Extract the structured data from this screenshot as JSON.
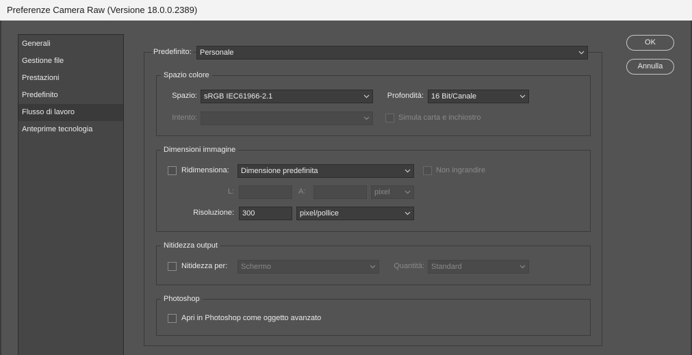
{
  "window": {
    "title": "Preferenze Camera Raw  (Versione 18.0.0.2389)"
  },
  "sidebar": {
    "items": [
      {
        "label": "Generali"
      },
      {
        "label": "Gestione file"
      },
      {
        "label": "Prestazioni"
      },
      {
        "label": "Predefinito"
      },
      {
        "label": "Flusso di lavoro",
        "selected": true
      },
      {
        "label": "Anteprime tecnologia"
      }
    ]
  },
  "preset": {
    "label": "Predefinito:",
    "value": "Personale"
  },
  "color_space": {
    "title": "Spazio colore",
    "space_label": "Spazio:",
    "space_value": "sRGB IEC61966-2.1",
    "depth_label": "Profondità:",
    "depth_value": "16 Bit/Canale",
    "intent_label": "Intento:",
    "intent_value": "",
    "simulate_label": "Simula carta e inchiostro"
  },
  "image_size": {
    "title": "Dimensioni immagine",
    "resize_label": "Ridimensiona:",
    "resize_value": "Dimensione predefinita",
    "no_enlarge_label": "Non ingrandire",
    "width_label": "L:",
    "height_label": "A:",
    "unit_value": "pixel",
    "resolution_label": "Risoluzione:",
    "resolution_value": "300",
    "resolution_unit": "pixel/pollice"
  },
  "sharpening": {
    "title": "Nitidezza output",
    "sharpen_label": "Nitidezza per:",
    "sharpen_value": "Schermo",
    "amount_label": "Quantità:",
    "amount_value": "Standard"
  },
  "photoshop": {
    "title": "Photoshop",
    "smart_object_label": "Apri in Photoshop come oggetto avanzato"
  },
  "buttons": {
    "ok": "OK",
    "cancel": "Annulla"
  }
}
